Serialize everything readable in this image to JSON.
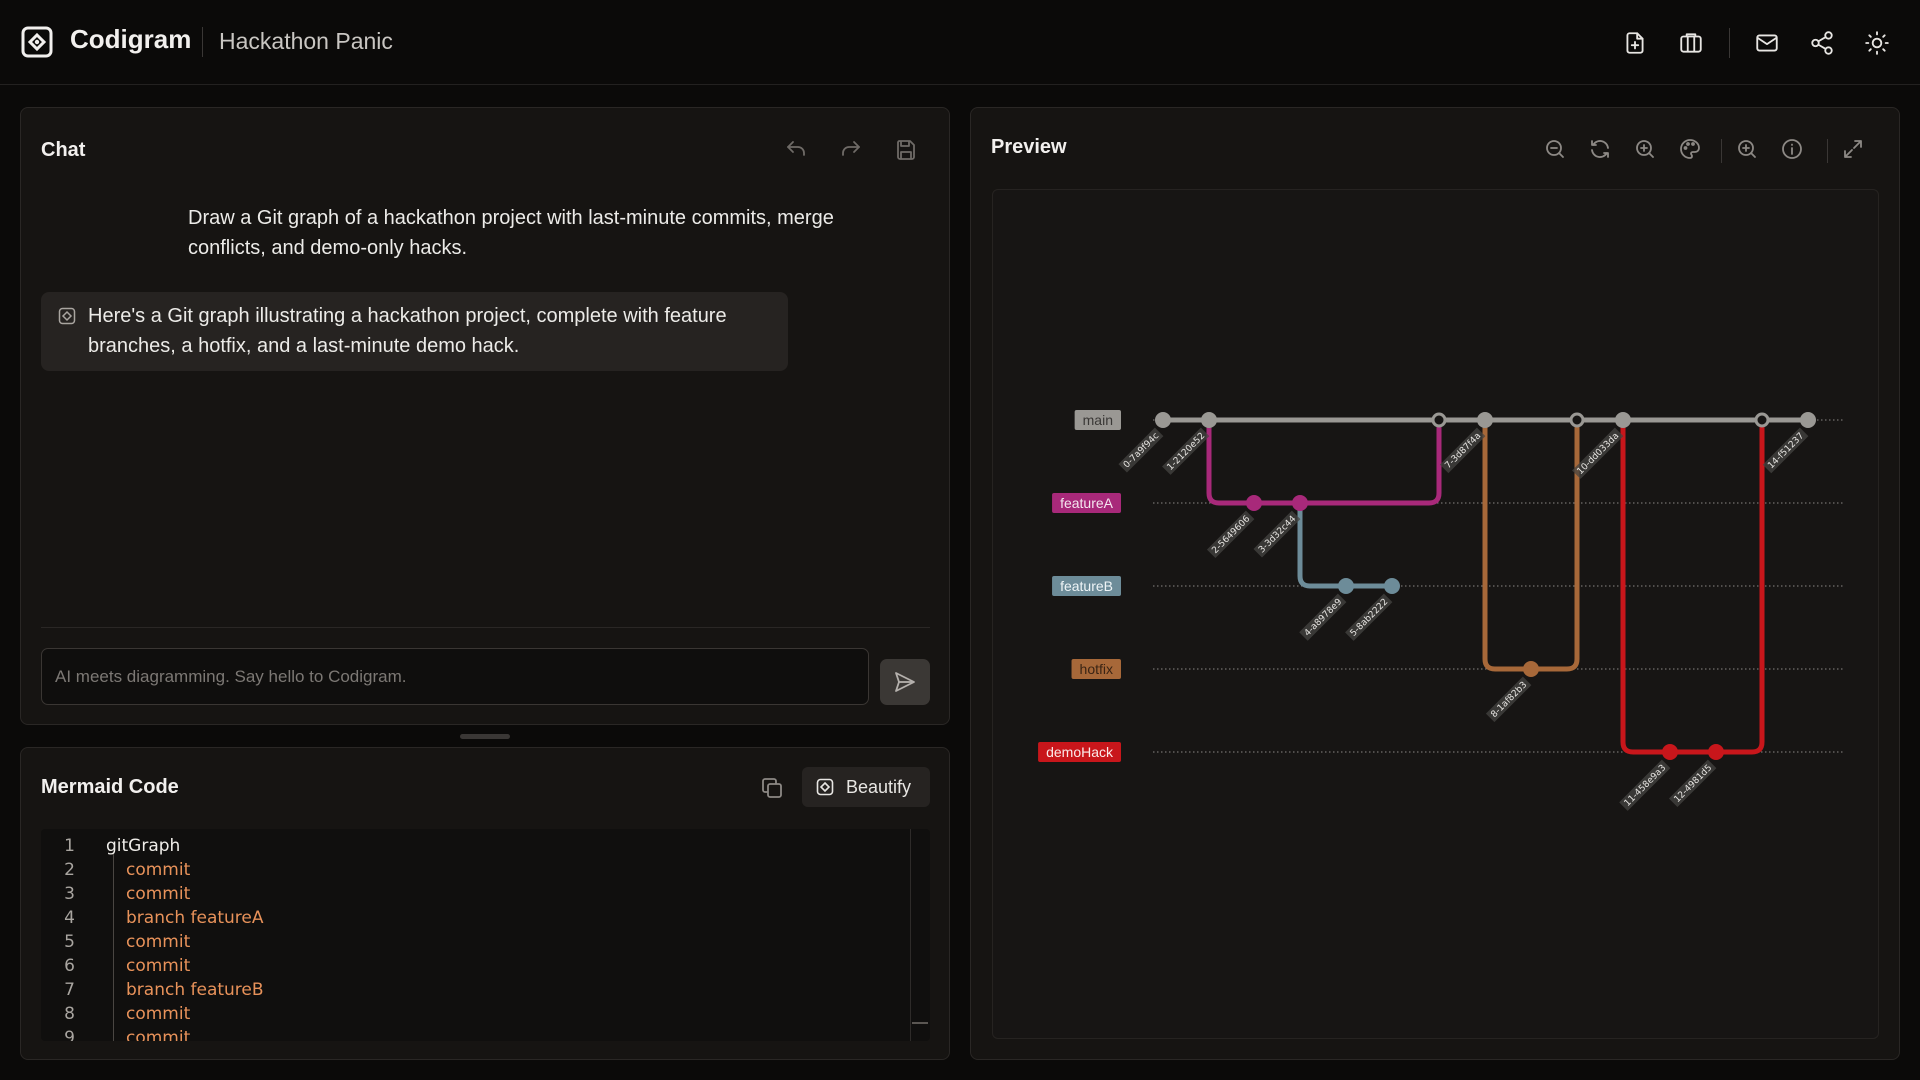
{
  "app": {
    "brand": "Codigram",
    "project_title": "Hackathon Panic"
  },
  "toolbar_icons": [
    "new-file-icon",
    "box-icon",
    "mail-icon",
    "share-icon",
    "sun-icon"
  ],
  "chat": {
    "title": "Chat",
    "user_message": "Draw a Git graph of a hackathon project with last-minute commits, merge conflicts, and demo-only hacks.",
    "bot_message": "Here's a Git graph illustrating a hackathon project, complete with feature branches, a hotfix, and a last-minute demo hack.",
    "input_placeholder": "AI meets diagramming. Say hello to Codigram.",
    "input_value": ""
  },
  "code": {
    "title": "Mermaid Code",
    "beautify_label": "Beautify",
    "lines": [
      {
        "n": "1",
        "text": "gitGraph"
      },
      {
        "n": "2",
        "text": "commit"
      },
      {
        "n": "3",
        "text": "commit"
      },
      {
        "n": "4",
        "text": "branch featureA"
      },
      {
        "n": "5",
        "text": "commit"
      },
      {
        "n": "6",
        "text": "commit"
      },
      {
        "n": "7",
        "text": "branch featureB"
      },
      {
        "n": "8",
        "text": "commit"
      },
      {
        "n": "9",
        "text": "commit"
      }
    ]
  },
  "preview": {
    "title": "Preview",
    "branches": [
      {
        "name": "main",
        "color": "#9a9894",
        "text_color": "#3a3836"
      },
      {
        "name": "featureA",
        "color": "#a8297a",
        "text_color": "#f4e6ef"
      },
      {
        "name": "featureB",
        "color": "#6d8c99",
        "text_color": "#eef4f6"
      },
      {
        "name": "hotfix",
        "color": "#a76839",
        "text_color": "#3a2414"
      },
      {
        "name": "demoHack",
        "color": "#c8161b",
        "text_color": "#fbeaea"
      }
    ],
    "commits": [
      {
        "id": "0-7a9f94c",
        "branch": 0
      },
      {
        "id": "1-2120e52",
        "branch": 0
      },
      {
        "id": "2-5649606",
        "branch": 1
      },
      {
        "id": "3-3d32c44",
        "branch": 1
      },
      {
        "id": "4-a8978e9",
        "branch": 2
      },
      {
        "id": "5-8ab2222",
        "branch": 2
      },
      {
        "id": "6-merge",
        "branch": 0
      },
      {
        "id": "7-3d87f4a",
        "branch": 0
      },
      {
        "id": "8-1af82b3",
        "branch": 3
      },
      {
        "id": "9-merge",
        "branch": 0
      },
      {
        "id": "10-dd033da",
        "branch": 0
      },
      {
        "id": "11-458e9a3",
        "branch": 4
      },
      {
        "id": "12-4981d5",
        "branch": 4
      },
      {
        "id": "13-merge",
        "branch": 0
      },
      {
        "id": "14-f51237",
        "branch": 0
      }
    ]
  }
}
